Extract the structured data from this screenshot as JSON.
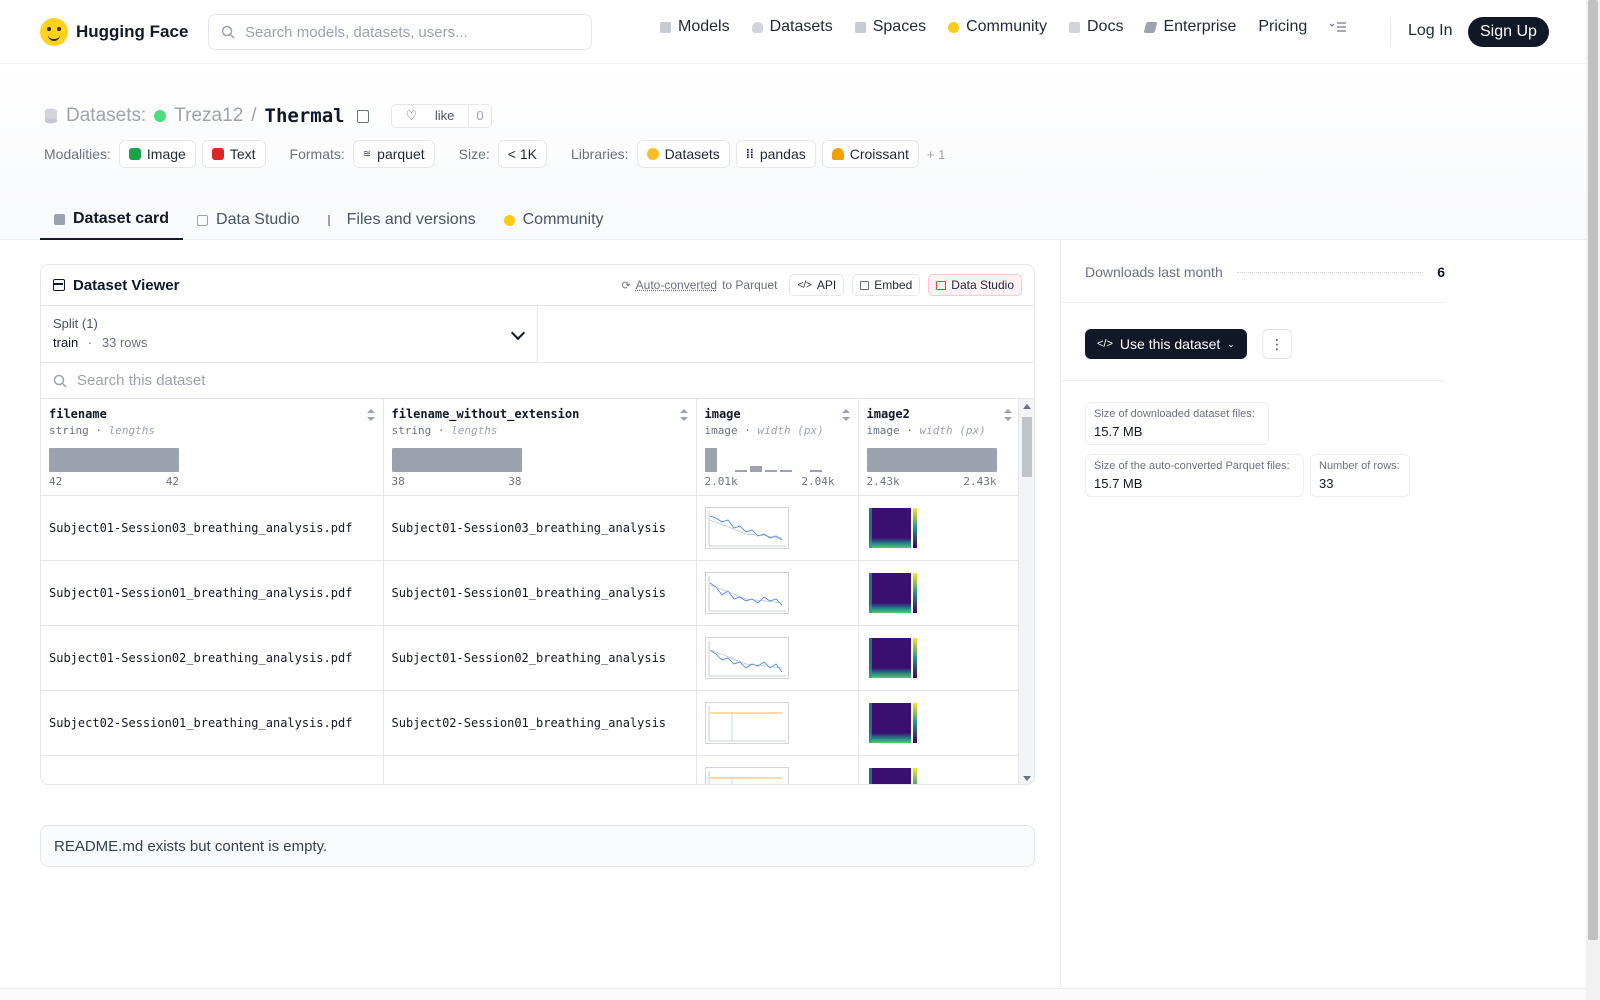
{
  "brand": {
    "name": "Hugging Face"
  },
  "search": {
    "placeholder": "Search models, datasets, users..."
  },
  "nav": {
    "links": [
      "Models",
      "Datasets",
      "Spaces",
      "Community",
      "Docs",
      "Enterprise",
      "Pricing"
    ],
    "login": "Log In",
    "signup": "Sign Up"
  },
  "repo": {
    "section": "Datasets:",
    "owner": "Treza12",
    "separator": "/",
    "name": "Thermal",
    "like_label": "like",
    "like_count": "0"
  },
  "meta": {
    "modalities_label": "Modalities:",
    "modalities": [
      "Image",
      "Text"
    ],
    "formats_label": "Formats:",
    "formats": [
      "parquet"
    ],
    "size_label": "Size:",
    "size": "< 1K",
    "libraries_label": "Libraries:",
    "libraries": [
      "Datasets",
      "pandas",
      "Croissant"
    ],
    "more": "+ 1"
  },
  "tabs": [
    "Dataset card",
    "Data Studio",
    "Files and versions",
    "Community"
  ],
  "viewer": {
    "title": "Dataset Viewer",
    "auto_converted": "Auto-converted",
    "to_parquet": "to Parquet",
    "api": "API",
    "embed": "Embed",
    "data_studio": "Data Studio",
    "split_label": "Split (1)",
    "split_name": "train",
    "split_sep": "·",
    "split_rows": "33 rows",
    "search_placeholder": "Search this dataset",
    "columns": [
      {
        "name": "filename",
        "type": "string",
        "stat": "lengths",
        "min": "42",
        "max": "42"
      },
      {
        "name": "filename_without_extension",
        "type": "string",
        "stat": "lengths",
        "min": "38",
        "max": "38"
      },
      {
        "name": "image",
        "type": "image",
        "stat": "width (px)",
        "min": "2.01k",
        "max": "2.04k"
      },
      {
        "name": "image2",
        "type": "image",
        "stat": "width (px)",
        "min": "2.43k",
        "max": "2.43k"
      }
    ],
    "image_width_histogram": [
      1.0,
      0.0,
      0.08,
      0.25,
      0.08,
      0.1,
      0.0,
      0.05
    ],
    "rows": [
      {
        "filename": "Subject01-Session03_breathing_analysis.pdf",
        "stem": "Subject01-Session03_breathing_analysis"
      },
      {
        "filename": "Subject01-Session01_breathing_analysis.pdf",
        "stem": "Subject01-Session01_breathing_analysis"
      },
      {
        "filename": "Subject01-Session02_breathing_analysis.pdf",
        "stem": "Subject01-Session02_breathing_analysis"
      },
      {
        "filename": "Subject02-Session01_breathing_analysis.pdf",
        "stem": "Subject02-Session01_breathing_analysis"
      },
      {
        "filename": "",
        "stem": ""
      }
    ]
  },
  "readme": {
    "text": "README.md exists but content is empty."
  },
  "sidebar": {
    "downloads_label": "Downloads last month",
    "downloads_value": "6",
    "use_button": "Use this dataset",
    "stats": [
      {
        "label": "Size of downloaded dataset files:",
        "value": "15.7 MB"
      },
      {
        "label": "Size of the auto-converted Parquet files:",
        "value": "15.7 MB"
      },
      {
        "label": "Number of rows:",
        "value": "33"
      }
    ]
  },
  "colors": {
    "accent_dark": "#111827",
    "status_green": "#4ade80",
    "brand_yellow": "#ffd21e",
    "studio_red": "#ef4444"
  }
}
